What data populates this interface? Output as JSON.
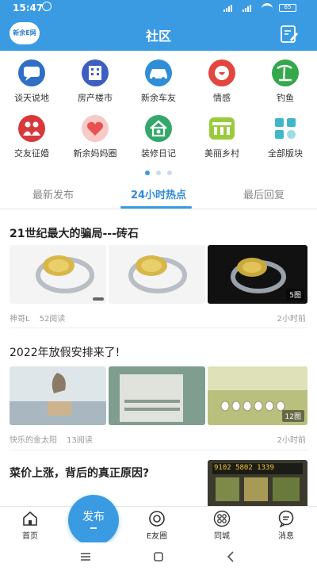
{
  "status_bar": {
    "time": "15:47",
    "battery": "65"
  },
  "header": {
    "title": "社区",
    "logo_text": "新余E网"
  },
  "categories": [
    {
      "label": "谈天说地",
      "icon": "chat-icon",
      "color": "#2f6fc4"
    },
    {
      "label": "房产楼市",
      "icon": "building-icon",
      "color": "#3d5fc0"
    },
    {
      "label": "新余车友",
      "icon": "car-icon",
      "color": "#2f8ed8"
    },
    {
      "label": "情感",
      "icon": "heart-face-icon",
      "color": "#e2463e"
    },
    {
      "label": "钓鱼",
      "icon": "fishing-icon",
      "color": "#34a84a"
    },
    {
      "label": "交友征婚",
      "icon": "couple-icon",
      "color": "#d9383a"
    },
    {
      "label": "新余妈妈圈",
      "icon": "mom-heart-icon",
      "color": "#f1a8a8"
    },
    {
      "label": "装修日记",
      "icon": "home-icon",
      "color": "#34a86a"
    },
    {
      "label": "美丽乡村",
      "icon": "village-icon",
      "color": "#9acb3c"
    },
    {
      "label": "全部版块",
      "icon": "grid-icon",
      "color": "#3fb7c9"
    }
  ],
  "tabs": [
    {
      "label": "最新发布",
      "active": false
    },
    {
      "label": "24小时热点",
      "active": true
    },
    {
      "label": "最后回复",
      "active": false
    }
  ],
  "posts": [
    {
      "title": "21世纪最大的骗局---砖石",
      "author": "神哥L",
      "reads": "52阅读",
      "time": "2小时前",
      "image_count": "5图"
    },
    {
      "title": "2022年放假安排来了!",
      "author": "快乐的金太阳",
      "reads": "13阅读",
      "time": "2小时前",
      "image_count": "12图"
    },
    {
      "title": "菜价上涨，背后的真正原因?",
      "sign_text": "9102 5802 1339"
    }
  ],
  "bottom_nav": [
    {
      "label": "首页",
      "icon": "home-nav-icon"
    },
    {
      "label": "E友圈",
      "icon": "camera-circle-icon"
    },
    {
      "label": "同城",
      "icon": "grid-circle-icon"
    },
    {
      "label": "消息",
      "icon": "message-icon"
    }
  ],
  "publish": {
    "label": "发布"
  },
  "colors": {
    "primary": "#3a9be3",
    "active_tab": "#2f8ad8"
  }
}
